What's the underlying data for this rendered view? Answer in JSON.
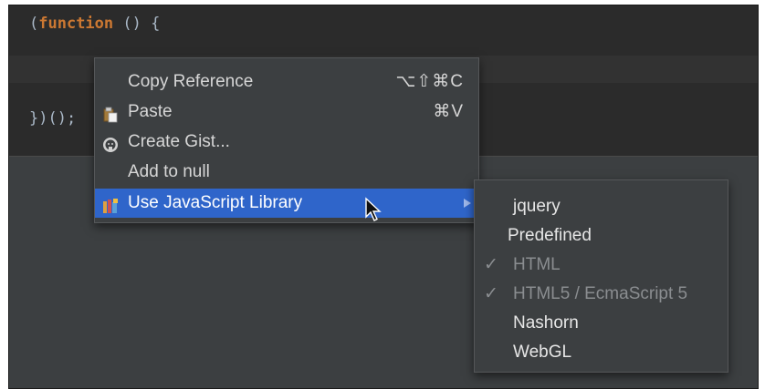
{
  "editor": {
    "line1": {
      "keyword": "function",
      "open": "(",
      "rest": " () {"
    },
    "line2": {
      "text": "})();"
    }
  },
  "context_menu": {
    "items": [
      {
        "label": "Copy Reference",
        "shortcut": "⌥⇧⌘C",
        "icon": null
      },
      {
        "label": "Paste",
        "shortcut": "⌘V",
        "icon": "clipboard-icon"
      },
      {
        "label": "Create Gist...",
        "shortcut": "",
        "icon": "github-icon"
      },
      {
        "label": "Add to null",
        "shortcut": "",
        "icon": null
      },
      {
        "label": "Use JavaScript Library",
        "shortcut": "",
        "icon": "js-library-icon",
        "selected": true,
        "has_submenu": true
      }
    ]
  },
  "submenu": {
    "items": [
      {
        "label": "jquery",
        "checked": false,
        "disabled": false
      },
      {
        "label": "Predefined",
        "checked": false,
        "disabled": false
      },
      {
        "label": "HTML",
        "checked": true,
        "disabled": true
      },
      {
        "label": "HTML5 / EcmaScript 5",
        "checked": true,
        "disabled": true
      },
      {
        "label": "Nashorn",
        "checked": false,
        "disabled": false
      },
      {
        "label": "WebGL",
        "checked": false,
        "disabled": false
      }
    ],
    "check_glyph": "✓"
  },
  "colors": {
    "selection": "#2f65ca",
    "keyword": "#cc7832",
    "menu_bg": "#3c3f41",
    "editor_bg": "#2b2b2b"
  }
}
